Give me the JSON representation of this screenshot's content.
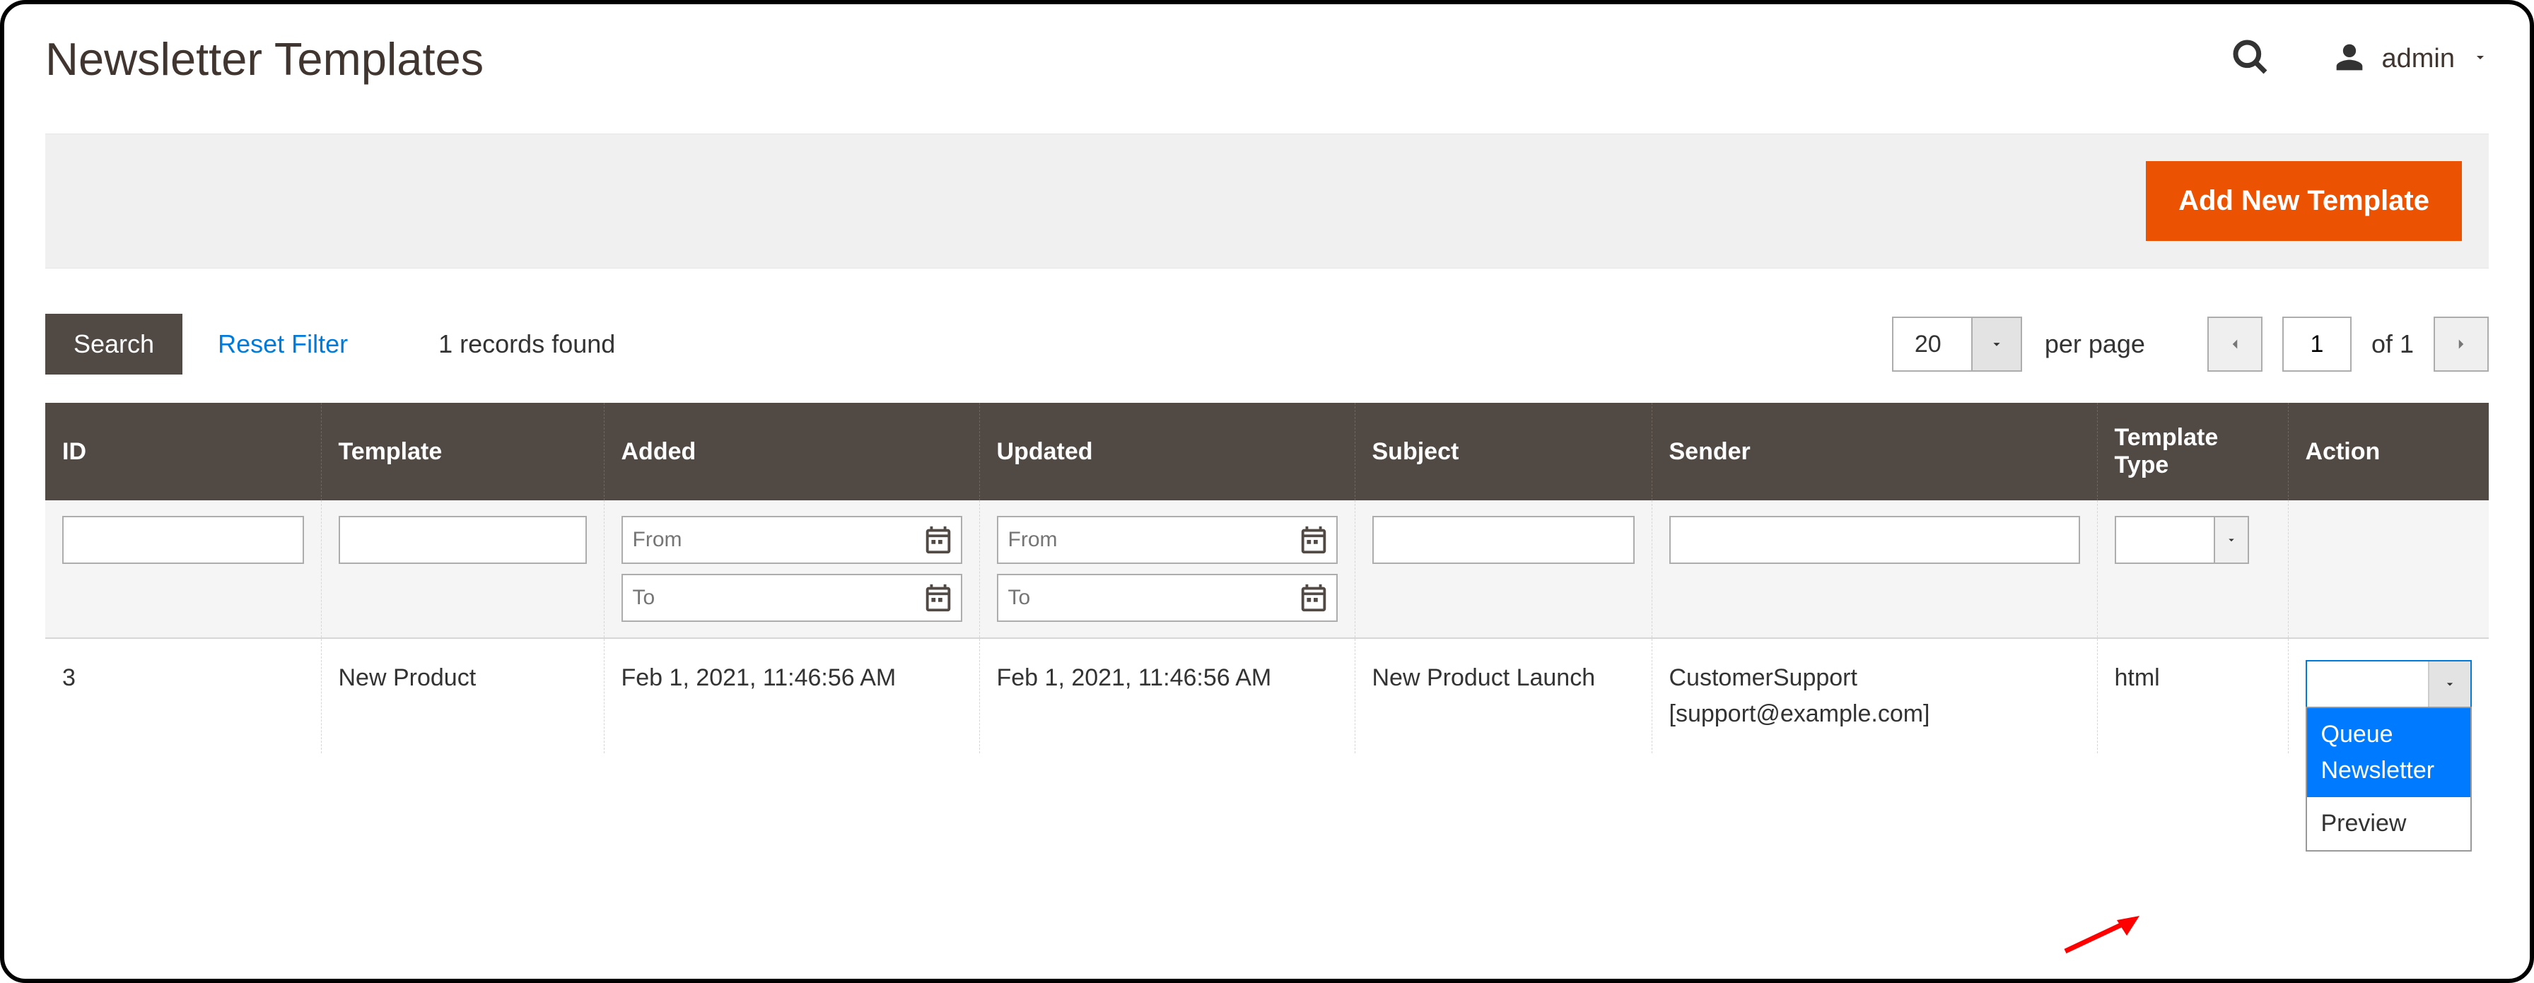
{
  "header": {
    "title": "Newsletter Templates",
    "user_name": "admin"
  },
  "action_bar": {
    "add_button": "Add New Template"
  },
  "toolbar": {
    "search_label": "Search",
    "reset_label": "Reset Filter",
    "records_found": "1 records found",
    "page_size": "20",
    "per_page_label": "per page",
    "current_page": "1",
    "of_label": "of 1"
  },
  "columns": {
    "id": "ID",
    "template": "Template",
    "added": "Added",
    "updated": "Updated",
    "subject": "Subject",
    "sender": "Sender",
    "template_type": "Template Type",
    "action": "Action"
  },
  "filters": {
    "from_placeholder": "From",
    "to_placeholder": "To"
  },
  "rows": [
    {
      "id": "3",
      "template": "New Product",
      "added": "Feb 1, 2021, 11:46:56 AM",
      "updated": "Feb 1, 2021, 11:46:56 AM",
      "subject": "New Product Launch",
      "sender": "CustomerSupport [support@example.com]",
      "template_type": "html"
    }
  ],
  "action_dropdown": {
    "queue": "Queue Newsletter",
    "preview": "Preview"
  }
}
